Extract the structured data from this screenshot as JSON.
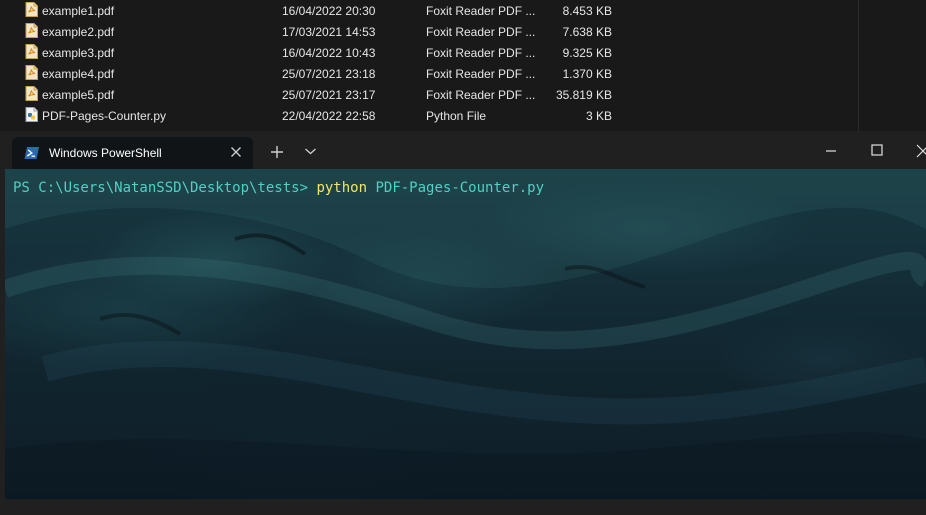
{
  "explorer": {
    "files": [
      {
        "name": "example1.pdf",
        "date": "16/04/2022 20:30",
        "type": "Foxit Reader PDF ...",
        "size": "8.453 KB",
        "icon": "pdf-file-icon"
      },
      {
        "name": "example2.pdf",
        "date": "17/03/2021 14:53",
        "type": "Foxit Reader PDF ...",
        "size": "7.638 KB",
        "icon": "pdf-file-icon"
      },
      {
        "name": "example3.pdf",
        "date": "16/04/2022 10:43",
        "type": "Foxit Reader PDF ...",
        "size": "9.325 KB",
        "icon": "pdf-file-icon"
      },
      {
        "name": "example4.pdf",
        "date": "25/07/2021 23:18",
        "type": "Foxit Reader PDF ...",
        "size": "1.370 KB",
        "icon": "pdf-file-icon"
      },
      {
        "name": "example5.pdf",
        "date": "25/07/2021 23:17",
        "type": "Foxit Reader PDF ...",
        "size": "35.819 KB",
        "icon": "pdf-file-icon"
      },
      {
        "name": "PDF-Pages-Counter.py",
        "date": "22/04/2022 22:58",
        "type": "Python File",
        "size": "3 KB",
        "icon": "python-file-icon"
      }
    ]
  },
  "terminal": {
    "tab_title": "Windows PowerShell",
    "prompt": "PS C:\\Users\\NatanSSD\\Desktop\\tests>",
    "command": "python",
    "argument": "PDF-Pages-Counter.py",
    "colors": {
      "prompt": "#4fd1c5",
      "command": "#f2e56b",
      "tab_bg": "#111417",
      "chrome_bg": "#202020"
    }
  }
}
